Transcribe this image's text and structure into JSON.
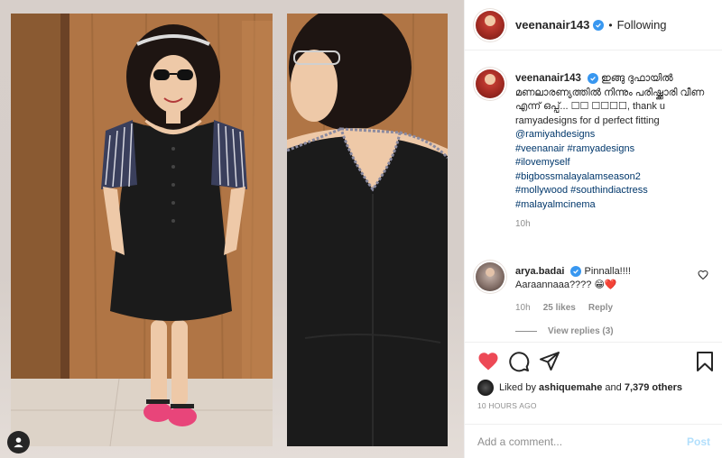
{
  "post": {
    "author": "veenanair143",
    "follow_status": "Following",
    "separator": "•"
  },
  "caption": {
    "username": "veenanair143",
    "text_malayalam": "ഇങ്ങു ദുഫായിൽ മണലാരണ്യത്തിൽ നിന്നും പരിഷ്ക്കാരി വീണ എന്ന് ഒപ്പ്... ☐☐ ☐☐☐☐, thank u ramyadesigns for d perfect fitting",
    "mention": "@ramiyahdesigns",
    "hashtags": [
      "#veenanair #ramyadesigns",
      "#ilovemyself",
      "#bigbossmalayalamseason2",
      "#mollywood #southindiactress",
      "#malayalmcinema"
    ],
    "time": "10h"
  },
  "comment": {
    "username": "arya.badai",
    "text": "Pinnalla!!!! Aaraannaaa???? 😁❤️",
    "time": "10h",
    "likes": "25 likes",
    "reply": "Reply",
    "view_replies": "View replies (3)"
  },
  "likes": {
    "prefix": "Liked by",
    "user": "ashiquemahe",
    "joiner": "and",
    "count": "7,379 others"
  },
  "posted": "10 HOURS AGO",
  "composer": {
    "placeholder": "Add a comment...",
    "post_label": "Post"
  },
  "icons": {
    "like": "heart-filled-icon",
    "comment": "comment-bubble-icon",
    "share": "paper-plane-icon",
    "save": "bookmark-icon",
    "tag": "user-tag-icon",
    "verified": "verified-badge-icon"
  },
  "colors": {
    "like_red": "#ed4956",
    "link_blue": "#00376b",
    "verified_blue": "#3897f0",
    "muted_grey": "#8e8e8e",
    "post_button_disabled": "#b2dffc"
  }
}
